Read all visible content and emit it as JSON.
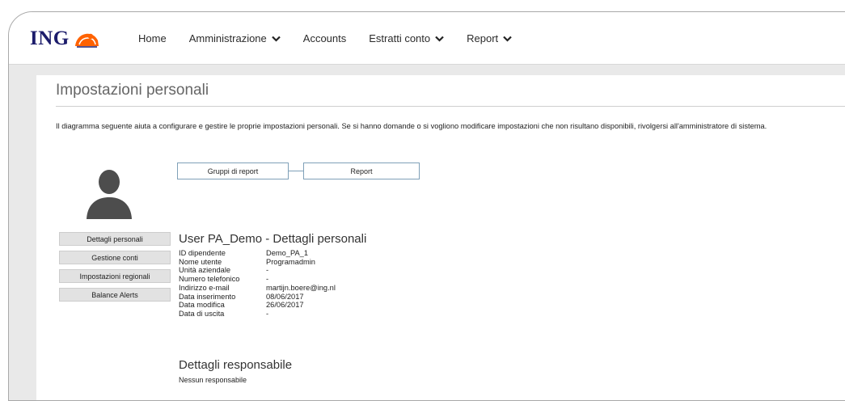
{
  "brand": {
    "logo_text": "ING"
  },
  "nav": {
    "items": [
      {
        "label": "Home",
        "has_dropdown": false
      },
      {
        "label": "Amministrazione",
        "has_dropdown": true
      },
      {
        "label": "Accounts",
        "has_dropdown": false
      },
      {
        "label": "Estratti conto",
        "has_dropdown": true
      },
      {
        "label": "Report",
        "has_dropdown": true
      }
    ]
  },
  "page": {
    "title": "Impostazioni personali",
    "intro": "Il diagramma seguente aiuta a configurare e gestire le proprie impostazioni personali. Se si hanno domande o si vogliono modificare impostazioni che non risultano disponibili, rivolgersi all'amministratore di sistema."
  },
  "flow": {
    "left_label": "Gruppi di report",
    "right_label": "Report"
  },
  "sidebar": {
    "items": [
      {
        "label": "Dettagli personali"
      },
      {
        "label": "Gestione conti"
      },
      {
        "label": "Impostazioni regionali"
      },
      {
        "label": "Balance Alerts"
      }
    ]
  },
  "details": {
    "title": "User PA_Demo - Dettagli personali",
    "rows": [
      {
        "label": "ID dipendente",
        "value": "Demo_PA_1"
      },
      {
        "label": "Nome utente",
        "value": "Programadmin"
      },
      {
        "label": "Unità aziendale",
        "value": "-"
      },
      {
        "label": "Numero telefonico",
        "value": "-"
      },
      {
        "label": "Indirizzo e-mail",
        "value": "martijn.boere@ing.nl"
      },
      {
        "label": "Data inserimento",
        "value": "08/06/2017"
      },
      {
        "label": "Data modifica",
        "value": "26/06/2017"
      },
      {
        "label": "Data di uscita",
        "value": "-"
      }
    ]
  },
  "responsible": {
    "title": "Dettagli responsabile",
    "text": "Nessun responsabile"
  },
  "colors": {
    "brand_navy": "#1c1c6b",
    "lion_orange": "#ff6200",
    "flow_border": "#7fa0b8"
  }
}
